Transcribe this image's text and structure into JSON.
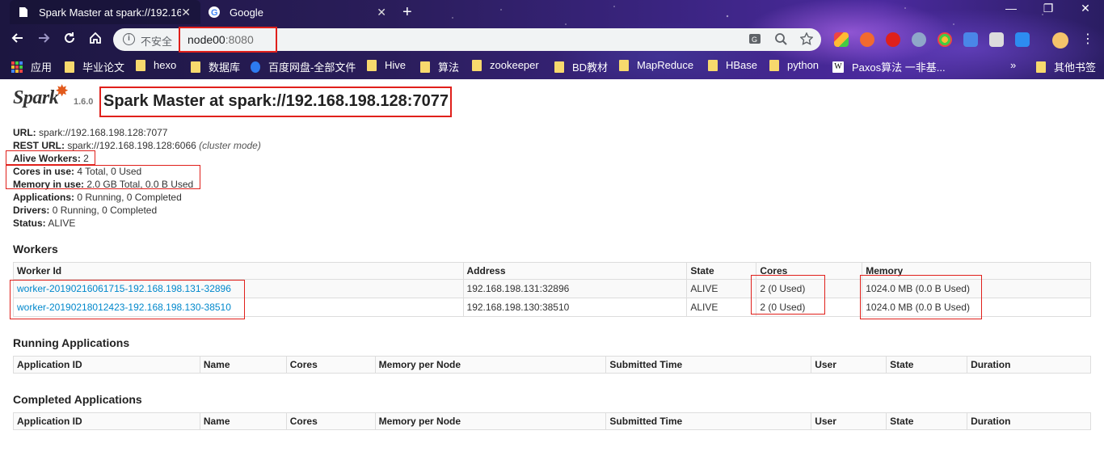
{
  "browser": {
    "tabs": [
      {
        "title": "Spark Master at spark://192.16",
        "active": true
      },
      {
        "title": "Google",
        "active": false
      }
    ],
    "new_tab_symbol": "+",
    "window_controls": [
      "—",
      "❐",
      "✕"
    ],
    "address": {
      "security_label": "不安全",
      "host": "node00",
      "port": ":8080"
    },
    "bookmarks": [
      {
        "label": "应用",
        "icon": "apps-icon"
      },
      {
        "label": "毕业论文",
        "icon": "folder-icon"
      },
      {
        "label": "hexo",
        "icon": "folder-icon"
      },
      {
        "label": "数据库",
        "icon": "folder-icon"
      },
      {
        "label": "百度网盘-全部文件",
        "icon": "baidu-cloud-icon"
      },
      {
        "label": "Hive",
        "icon": "folder-icon"
      },
      {
        "label": "算法",
        "icon": "folder-icon"
      },
      {
        "label": "zookeeper",
        "icon": "folder-icon"
      },
      {
        "label": "BD教材",
        "icon": "folder-icon"
      },
      {
        "label": "MapReduce",
        "icon": "folder-icon"
      },
      {
        "label": "HBase",
        "icon": "folder-icon"
      },
      {
        "label": "python",
        "icon": "folder-icon"
      },
      {
        "label": "Paxos算法 一非基...",
        "icon": "wikipedia-icon"
      }
    ],
    "bookmarks_overflow": "»",
    "other_bookmarks": "其他书签"
  },
  "spark": {
    "logo_text": "Spark",
    "version": "1.6.0",
    "title": "Spark Master at spark://192.168.198.128:7077",
    "info": [
      {
        "label": "URL:",
        "value": "spark://192.168.198.128:7077",
        "note": ""
      },
      {
        "label": "REST URL:",
        "value": "spark://192.168.198.128:6066",
        "note": "(cluster mode)"
      },
      {
        "label": "Alive Workers:",
        "value": "2",
        "note": ""
      },
      {
        "label": "Cores in use:",
        "value": "4 Total, 0 Used",
        "note": ""
      },
      {
        "label": "Memory in use:",
        "value": "2.0 GB Total, 0.0 B Used",
        "note": ""
      },
      {
        "label": "Applications:",
        "value": "0 Running, 0 Completed",
        "note": ""
      },
      {
        "label": "Drivers:",
        "value": "0 Running, 0 Completed",
        "note": ""
      },
      {
        "label": "Status:",
        "value": "ALIVE",
        "note": ""
      }
    ],
    "workers": {
      "title": "Workers",
      "columns": [
        "Worker Id",
        "Address",
        "State",
        "Cores",
        "Memory"
      ],
      "rows": [
        [
          "worker-20190216061715-192.168.198.131-32896",
          "192.168.198.131:32896",
          "ALIVE",
          "2 (0 Used)",
          "1024.0 MB (0.0 B Used)"
        ],
        [
          "worker-20190218012423-192.168.198.130-38510",
          "192.168.198.130:38510",
          "ALIVE",
          "2 (0 Used)",
          "1024.0 MB (0.0 B Used)"
        ]
      ]
    },
    "running_apps": {
      "title": "Running Applications",
      "columns": [
        "Application ID",
        "Name",
        "Cores",
        "Memory per Node",
        "Submitted Time",
        "User",
        "State",
        "Duration"
      ]
    },
    "completed_apps": {
      "title": "Completed Applications",
      "columns": [
        "Application ID",
        "Name",
        "Cores",
        "Memory per Node",
        "Submitted Time",
        "User",
        "State",
        "Duration"
      ]
    }
  },
  "colors": {
    "highlight_box": "#e0201b",
    "link": "#0088cc",
    "spark_orange": "#e25a1c"
  }
}
